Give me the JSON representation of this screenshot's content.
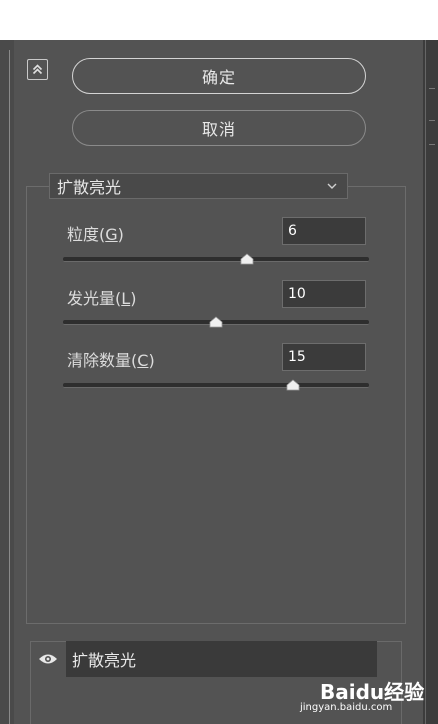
{
  "dialog": {
    "ok_label": "确定",
    "cancel_label": "取消",
    "filter_select": {
      "selected": "扩散亮光"
    },
    "params": [
      {
        "label": "粒度",
        "key": "G",
        "value": "6",
        "slider_fraction": 0.6
      },
      {
        "label": "发光量",
        "key": "L",
        "value": "10",
        "slider_fraction": 0.5
      },
      {
        "label": "清除数量",
        "key": "C",
        "value": "15",
        "slider_fraction": 0.75
      }
    ]
  },
  "layer_list": {
    "items": [
      {
        "name": "扩散亮光",
        "visible": true
      }
    ]
  },
  "watermark": {
    "logo": "Baidu经验",
    "sub": "jingyan.baidu.com"
  },
  "colors": {
    "panel_bg": "#535353",
    "input_bg": "#3b3b3b",
    "top_bar": "#ffffff"
  }
}
